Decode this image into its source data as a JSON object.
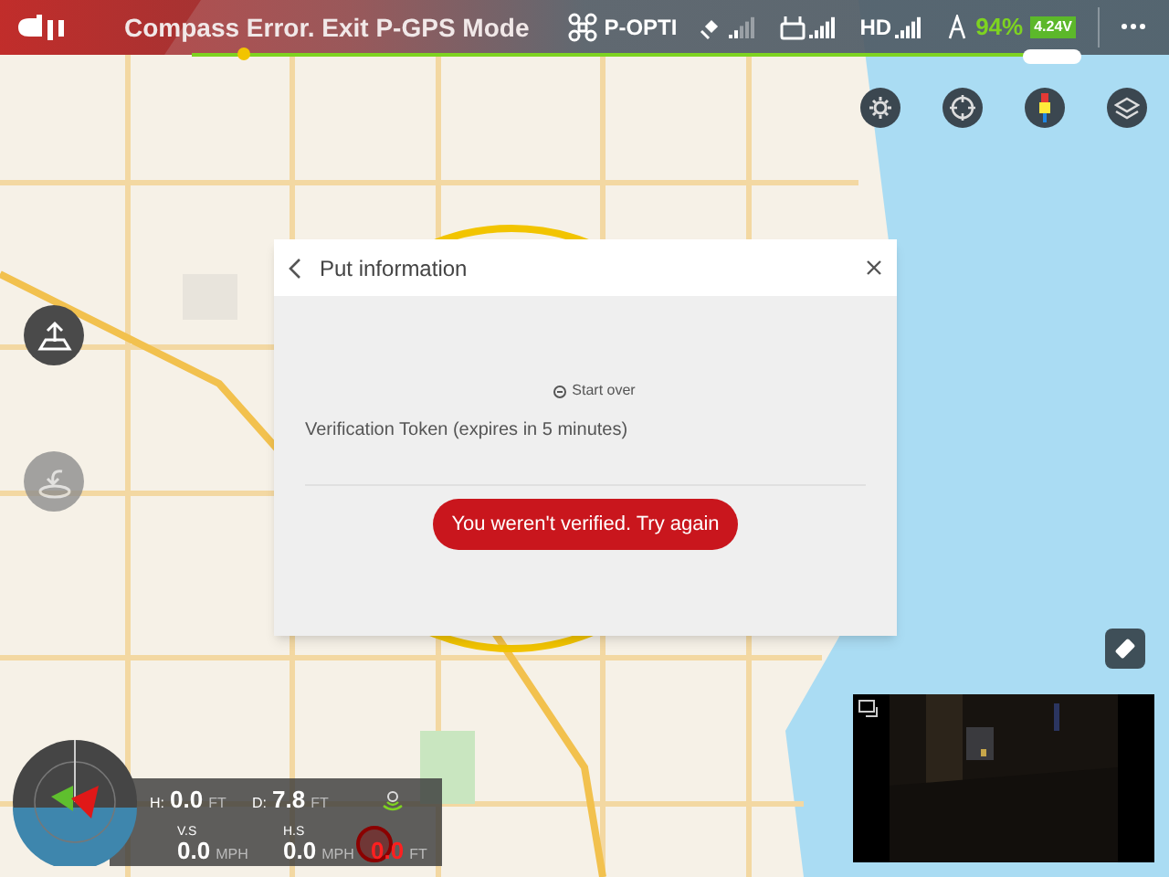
{
  "top_bar": {
    "alert": "Compass Error. Exit P-GPS Mode",
    "flight_mode": "P-OPTI",
    "video_link": "HD",
    "battery_percent": "94%",
    "battery_voltage": "4.24V"
  },
  "dialog": {
    "title": "Put information",
    "start_over": "Start over",
    "token_label": "Verification Token (expires in 5 minutes)",
    "error_button": "You weren't verified. Try again"
  },
  "telemetry": {
    "h_label": "H:",
    "h_value": "0.0",
    "h_unit": "FT",
    "d_label": "D:",
    "d_value": "7.8",
    "d_unit": "FT",
    "vs_label": "V.S",
    "vs_value": "0.0",
    "vs_unit": "MPH",
    "hs_label": "H.S",
    "hs_value": "0.0",
    "hs_unit": "MPH",
    "alt_value": "0.0",
    "alt_unit": "FT"
  }
}
